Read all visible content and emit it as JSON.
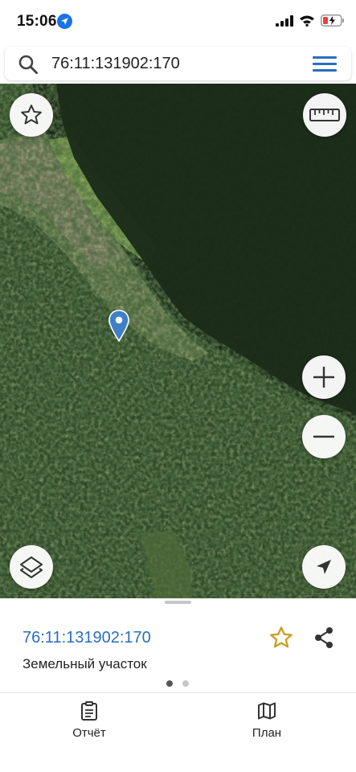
{
  "status_bar": {
    "time": "15:06",
    "icons": [
      "location-arrow-icon",
      "cellular-signal-icon",
      "wifi-icon",
      "battery-low-icon"
    ],
    "battery_color": "#e0443e"
  },
  "search": {
    "value": "76:11:131902:170",
    "placeholder": "",
    "icon": "search-icon",
    "menu_icon": "hamburger-menu-icon"
  },
  "map": {
    "type": "satellite",
    "controls": {
      "favorite": "star-icon",
      "ruler": "ruler-icon",
      "zoom_in": "plus-icon",
      "zoom_out": "minus-icon",
      "layers": "layers-icon",
      "locate": "navigation-arrow-icon"
    },
    "marker": "map-pin-icon",
    "accent": "#2a6ebf"
  },
  "sheet": {
    "cadastral_number": "76:11:131902:170",
    "object_type": "Земельный участок",
    "page_count": 2,
    "active_page": 1
  },
  "tabs": [
    {
      "label": "Отчёт",
      "icon": "clipboard-icon"
    },
    {
      "label": "План",
      "icon": "map-fold-icon"
    }
  ],
  "colors": {
    "accent": "#2a6ebf",
    "star": "#c9a227"
  }
}
